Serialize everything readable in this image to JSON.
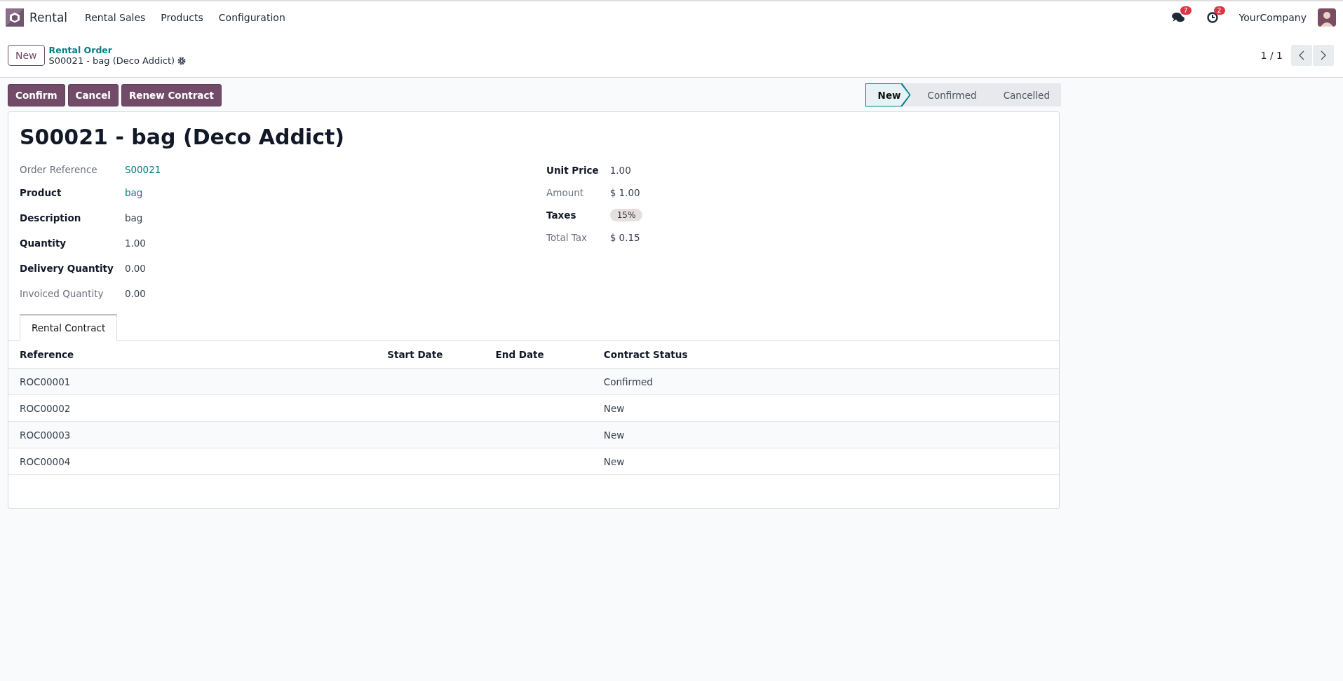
{
  "navbar": {
    "app_name": "Rental",
    "menu": [
      "Rental Sales",
      "Products",
      "Configuration"
    ],
    "messages_count": "7",
    "activities_count": "2",
    "company": "YourCompany"
  },
  "control_panel": {
    "new_button": "New",
    "breadcrumb": "Rental Order",
    "record_title": "S00021 - bag (Deco Addict)",
    "pager": "1 / 1"
  },
  "actions": [
    "Confirm",
    "Cancel",
    "Renew Contract"
  ],
  "statusbar": [
    {
      "label": "New",
      "selected": true
    },
    {
      "label": "Confirmed",
      "selected": false
    },
    {
      "label": "Cancelled",
      "selected": false
    }
  ],
  "form": {
    "title": "S00021 - bag (Deco Addict)",
    "left_fields": [
      {
        "label": "Order Reference",
        "readonly": true,
        "value": "S00021",
        "kind": "link"
      },
      {
        "label": "Product",
        "readonly": false,
        "value": "bag",
        "kind": "link"
      },
      {
        "label": "Description",
        "readonly": false,
        "value": "bag",
        "kind": "text"
      },
      {
        "label": "Quantity",
        "readonly": false,
        "value": "1.00",
        "kind": "text"
      },
      {
        "label": "Delivery Quantity",
        "readonly": false,
        "value": "0.00",
        "kind": "text"
      },
      {
        "label": "Invoiced Quantity",
        "readonly": true,
        "value": "0.00",
        "kind": "text"
      }
    ],
    "right_fields": [
      {
        "label": "Unit Price",
        "readonly": false,
        "value": "1.00",
        "kind": "text"
      },
      {
        "label": "Amount",
        "readonly": true,
        "value": "$ 1.00",
        "kind": "text"
      },
      {
        "label": "Taxes",
        "readonly": false,
        "value": "15%",
        "kind": "tag"
      },
      {
        "label": "Total Tax",
        "readonly": true,
        "value": "$ 0.15",
        "kind": "text"
      }
    ],
    "tabs": [
      {
        "label": "Rental Contract",
        "selected": true
      }
    ],
    "table": {
      "columns": [
        "Reference",
        "Start Date",
        "End Date",
        "Contract Status"
      ],
      "rows": [
        [
          "ROC00001",
          "",
          "",
          "Confirmed"
        ],
        [
          "ROC00002",
          "",
          "",
          "New"
        ],
        [
          "ROC00003",
          "",
          "",
          "New"
        ],
        [
          "ROC00004",
          "",
          "",
          "New"
        ]
      ]
    }
  }
}
